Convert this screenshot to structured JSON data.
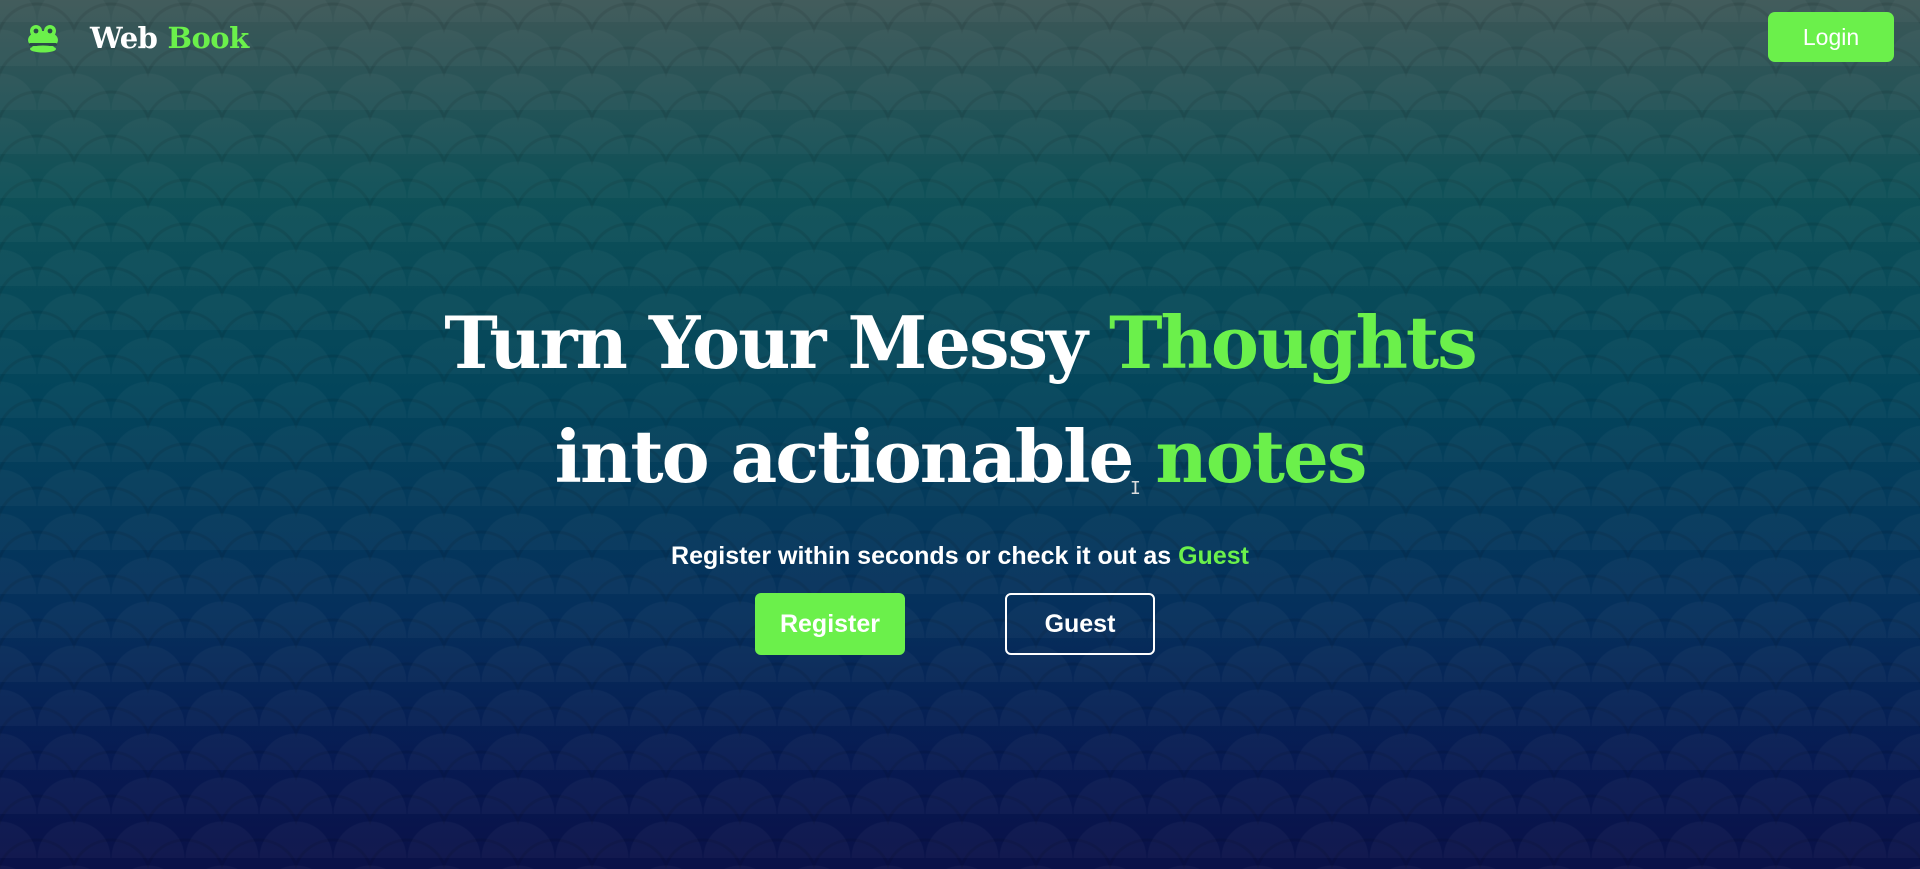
{
  "nav": {
    "brand_part1": "Web",
    "brand_part2": "Book",
    "login_label": "Login"
  },
  "hero": {
    "line1_a": "Turn Your Messy",
    "line1_b": "Thoughts",
    "line2_a": "into actionable",
    "line2_b": "notes",
    "subtext_a": "Register within seconds or check it out as",
    "subtext_b": "Guest",
    "register_label": "Register",
    "guest_label": "Guest"
  },
  "colors": {
    "accent": "#6bf04b",
    "text": "#ffffff",
    "bg_top": "#3d5757",
    "bg_bottom": "#0a1148"
  },
  "icons": {
    "logo": "frog-mascot-icon",
    "cursor": "text-cursor-icon"
  }
}
